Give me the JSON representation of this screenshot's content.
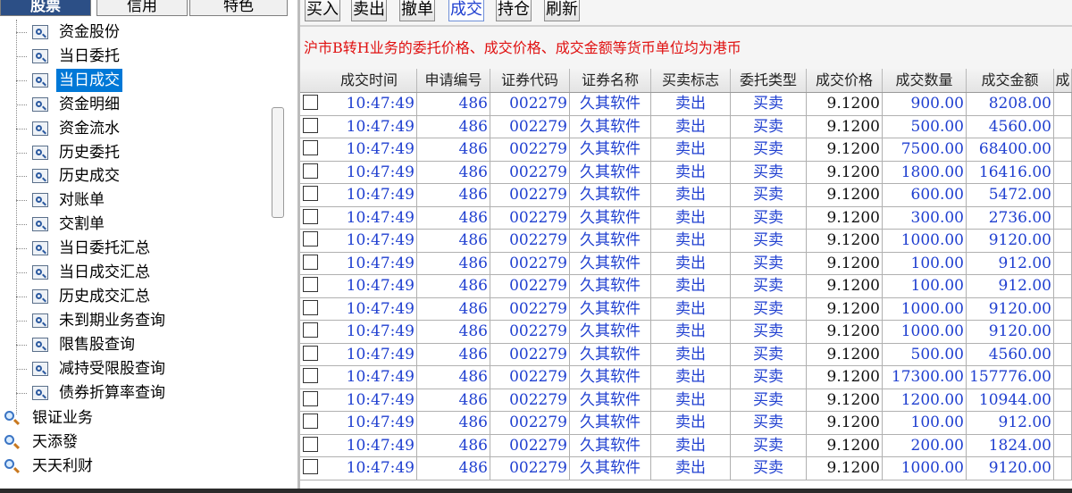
{
  "left_tabs": [
    {
      "label": "股票",
      "active": true
    },
    {
      "label": "信用",
      "active": false
    },
    {
      "label": "特色",
      "active": false
    }
  ],
  "tree_children": [
    {
      "label": "资金股份"
    },
    {
      "label": "当日委托"
    },
    {
      "label": "当日成交",
      "selected": true
    },
    {
      "label": "资金明细"
    },
    {
      "label": "资金流水"
    },
    {
      "label": "历史委托"
    },
    {
      "label": "历史成交"
    },
    {
      "label": "对账单"
    },
    {
      "label": "交割单"
    },
    {
      "label": "当日委托汇总"
    },
    {
      "label": "当日成交汇总"
    },
    {
      "label": "历史成交汇总"
    },
    {
      "label": "未到期业务查询"
    },
    {
      "label": "限售股查询"
    },
    {
      "label": "减持受限股查询"
    },
    {
      "label": "债券折算率查询"
    }
  ],
  "tree_roots": [
    {
      "label": "银证业务"
    },
    {
      "label": "天添發"
    },
    {
      "label": "天天利财"
    }
  ],
  "toolbar": [
    {
      "label": "买入",
      "active": false
    },
    {
      "label": "卖出",
      "active": false
    },
    {
      "label": "撤单",
      "active": false
    },
    {
      "label": "成交",
      "active": true
    },
    {
      "label": "持仓",
      "active": false
    },
    {
      "label": "刷新",
      "active": false
    }
  ],
  "notice": "沪市B转H业务的委托价格、成交价格、成交金额等货币单位均为港币",
  "table": {
    "columns": [
      "成交时间",
      "申请编号",
      "证券代码",
      "证券名称",
      "买卖标志",
      "委托类型",
      "成交价格",
      "成交数量",
      "成交金额",
      "成"
    ],
    "rows": [
      [
        "10:47:49",
        "486",
        "002279",
        "久其软件",
        "卖出",
        "买卖",
        "9.1200",
        "900.00",
        "8208.00"
      ],
      [
        "10:47:49",
        "486",
        "002279",
        "久其软件",
        "卖出",
        "买卖",
        "9.1200",
        "500.00",
        "4560.00"
      ],
      [
        "10:47:49",
        "486",
        "002279",
        "久其软件",
        "卖出",
        "买卖",
        "9.1200",
        "7500.00",
        "68400.00"
      ],
      [
        "10:47:49",
        "486",
        "002279",
        "久其软件",
        "卖出",
        "买卖",
        "9.1200",
        "1800.00",
        "16416.00"
      ],
      [
        "10:47:49",
        "486",
        "002279",
        "久其软件",
        "卖出",
        "买卖",
        "9.1200",
        "600.00",
        "5472.00"
      ],
      [
        "10:47:49",
        "486",
        "002279",
        "久其软件",
        "卖出",
        "买卖",
        "9.1200",
        "300.00",
        "2736.00"
      ],
      [
        "10:47:49",
        "486",
        "002279",
        "久其软件",
        "卖出",
        "买卖",
        "9.1200",
        "1000.00",
        "9120.00"
      ],
      [
        "10:47:49",
        "486",
        "002279",
        "久其软件",
        "卖出",
        "买卖",
        "9.1200",
        "100.00",
        "912.00"
      ],
      [
        "10:47:49",
        "486",
        "002279",
        "久其软件",
        "卖出",
        "买卖",
        "9.1200",
        "100.00",
        "912.00"
      ],
      [
        "10:47:49",
        "486",
        "002279",
        "久其软件",
        "卖出",
        "买卖",
        "9.1200",
        "1000.00",
        "9120.00"
      ],
      [
        "10:47:49",
        "486",
        "002279",
        "久其软件",
        "卖出",
        "买卖",
        "9.1200",
        "1000.00",
        "9120.00"
      ],
      [
        "10:47:49",
        "486",
        "002279",
        "久其软件",
        "卖出",
        "买卖",
        "9.1200",
        "500.00",
        "4560.00"
      ],
      [
        "10:47:49",
        "486",
        "002279",
        "久其软件",
        "卖出",
        "买卖",
        "9.1200",
        "17300.00",
        "157776.00"
      ],
      [
        "10:47:49",
        "486",
        "002279",
        "久其软件",
        "卖出",
        "买卖",
        "9.1200",
        "1200.00",
        "10944.00"
      ],
      [
        "10:47:49",
        "486",
        "002279",
        "久其软件",
        "卖出",
        "买卖",
        "9.1200",
        "100.00",
        "912.00"
      ],
      [
        "10:47:49",
        "486",
        "002279",
        "久其软件",
        "卖出",
        "买卖",
        "9.1200",
        "200.00",
        "1824.00"
      ],
      [
        "10:47:49",
        "486",
        "002279",
        "久其软件",
        "卖出",
        "买卖",
        "9.1200",
        "1000.00",
        "9120.00"
      ]
    ]
  },
  "colors": {
    "tab_active_bg": "#2c4f86",
    "selection_bg": "#0078d7",
    "grid_text": "#1f3fd0",
    "notice_text": "#e01010"
  }
}
